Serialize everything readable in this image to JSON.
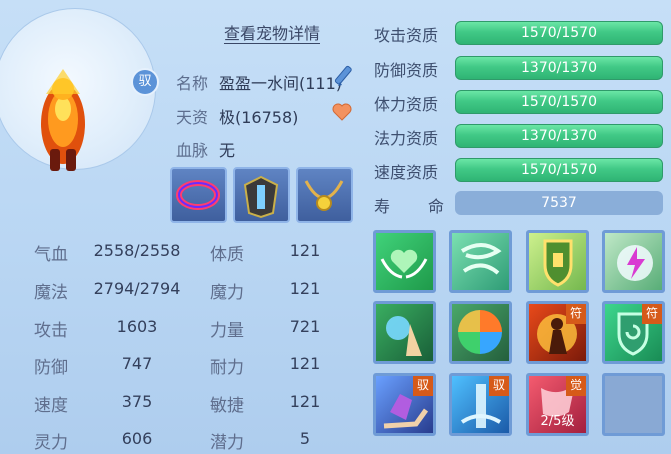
{
  "header": {
    "details_link": "查看宠物详情"
  },
  "pet": {
    "bound_badge": "驭",
    "name_label": "名称",
    "name_value": "盈盈一水间(111)",
    "talent_label": "天资",
    "talent_value": "极(16758)",
    "bloodline_label": "血脉",
    "bloodline_value": "无"
  },
  "equipment": [
    {
      "icon": "collar-icon"
    },
    {
      "icon": "armor-icon"
    },
    {
      "icon": "necklace-icon"
    }
  ],
  "aptitudes": [
    {
      "label": "攻击资质",
      "value": "1570/1570"
    },
    {
      "label": "防御资质",
      "value": "1370/1370"
    },
    {
      "label": "体力资质",
      "value": "1570/1570"
    },
    {
      "label": "法力资质",
      "value": "1370/1370"
    },
    {
      "label": "速度资质",
      "value": "1570/1570"
    }
  ],
  "life": {
    "label_a": "寿",
    "label_b": "命",
    "value": "7537"
  },
  "stats_left": [
    {
      "label": "气血",
      "value": "2558/2558"
    },
    {
      "label": "魔法",
      "value": "2794/2794"
    },
    {
      "label": "攻击",
      "value": "1603"
    },
    {
      "label": "防御",
      "value": "747"
    },
    {
      "label": "速度",
      "value": "375"
    },
    {
      "label": "灵力",
      "value": "606"
    }
  ],
  "stats_right": [
    {
      "label": "体质",
      "value": "121"
    },
    {
      "label": "魔力",
      "value": "121"
    },
    {
      "label": "力量",
      "value": "721"
    },
    {
      "label": "耐力",
      "value": "121"
    },
    {
      "label": "敏捷",
      "value": "121"
    },
    {
      "label": "潜力",
      "value": "5"
    }
  ],
  "skills": {
    "row1": [
      "heart-wings-icon",
      "wind-spirit-icon",
      "shield-emblem-icon",
      "lightning-orb-icon"
    ],
    "row2": [
      "water-hand-icon",
      "elements-icon",
      "fire-warrior-icon",
      "shield-spiral-icon"
    ],
    "row2_tags": {
      "fire": "符",
      "shield": "符"
    },
    "row3_tags": {
      "a": "驭",
      "b": "驭",
      "c": "觉"
    },
    "awaken_level": "2/5级"
  },
  "colors": {
    "apt_bar": "#41c986",
    "life_bar": "#8aaed9",
    "skill_border": "#6f9bd6"
  }
}
